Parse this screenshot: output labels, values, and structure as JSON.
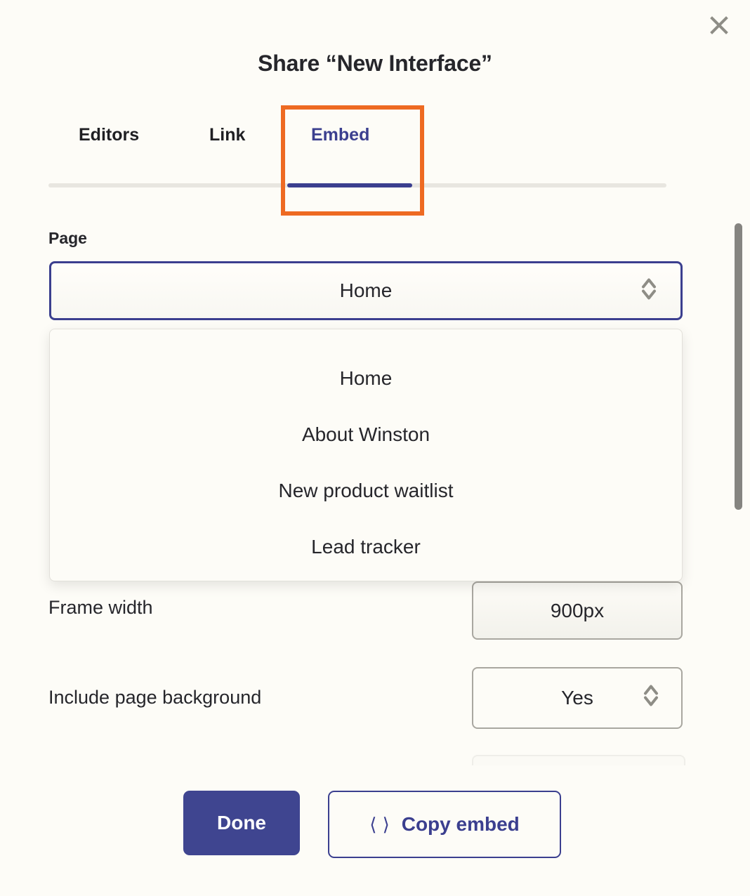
{
  "modal": {
    "title": "Share “New Interface”",
    "close_icon": "close-icon"
  },
  "tabs": [
    {
      "label": "Editors",
      "active": false
    },
    {
      "label": "Link",
      "active": false
    },
    {
      "label": "Embed",
      "active": true
    }
  ],
  "annotation": {
    "type": "highlight-rectangle",
    "target": "Embed",
    "color": "#ee6a22"
  },
  "form": {
    "page_field": {
      "label": "Page",
      "selected": "Home",
      "chevron_icon": "chevron-up-down-icon",
      "expanded": true,
      "options": [
        "Home",
        "About Winston",
        "New product waitlist",
        "Lead tracker"
      ]
    },
    "frame_width": {
      "label": "Frame width",
      "value": "900px"
    },
    "include_background": {
      "label": "Include page background",
      "value": "Yes",
      "chevron_icon": "chevron-up-down-icon"
    }
  },
  "footer": {
    "done_label": "Done",
    "copy_label": "Copy embed",
    "copy_icon": "code-brackets-icon"
  },
  "colors": {
    "background": "#fdfcf7",
    "accent_indigo": "#3b3f8f",
    "primary_button": "#3f4590",
    "highlight_orange": "#ee6a22",
    "text": "#26262b",
    "border_gray": "#a9a7a0",
    "scrollbar": "#858480"
  }
}
